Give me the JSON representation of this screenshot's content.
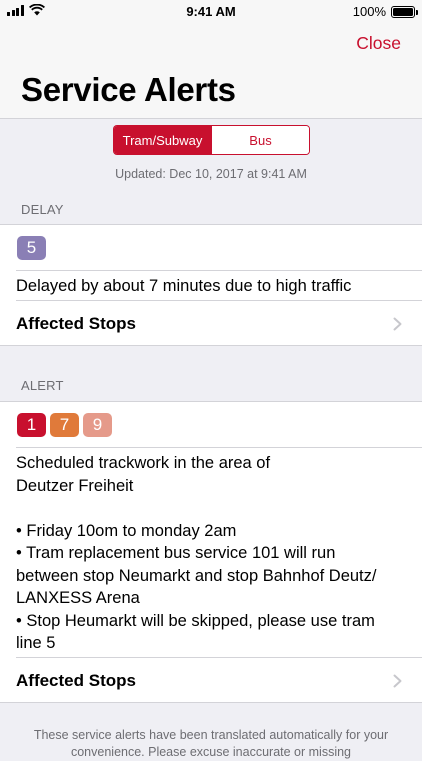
{
  "status_bar": {
    "time": "9:41 AM",
    "battery": "100%"
  },
  "header": {
    "close_label": "Close",
    "title": "Service Alerts"
  },
  "segmented": {
    "options": [
      "Tram/Subway",
      "Bus"
    ],
    "selected": "Tram/Subway"
  },
  "updated_text": "Updated: Dec 10, 2017 at 9:41 AM",
  "sections": [
    {
      "header": "DELAY",
      "badges": [
        {
          "label": "5",
          "color": "#8a7fb5"
        }
      ],
      "message_lines": [
        "Delayed by about 7 minutes due to high traffic"
      ],
      "affected_label": "Affected Stops"
    },
    {
      "header": "ALERT",
      "badges": [
        {
          "label": "1",
          "color": "#c8102e"
        },
        {
          "label": "7",
          "color": "#e07a3a"
        },
        {
          "label": "9",
          "color": "#e59a8a"
        }
      ],
      "message_lines": [
        "Scheduled trackwork in the area of",
        "Deutzer Freiheit",
        "",
        "• Friday 10om to monday 2am",
        "• Tram replacement bus service 101 will run",
        "between stop Neumarkt and stop Bahnhof Deutz/",
        "LANXESS Arena",
        "• Stop Heumarkt will be skipped, please use tram",
        "line 5"
      ],
      "affected_label": "Affected Stops"
    }
  ],
  "footer_note": "These service alerts have been translated automatically for your convenience. Please excuse inaccurate or missing"
}
